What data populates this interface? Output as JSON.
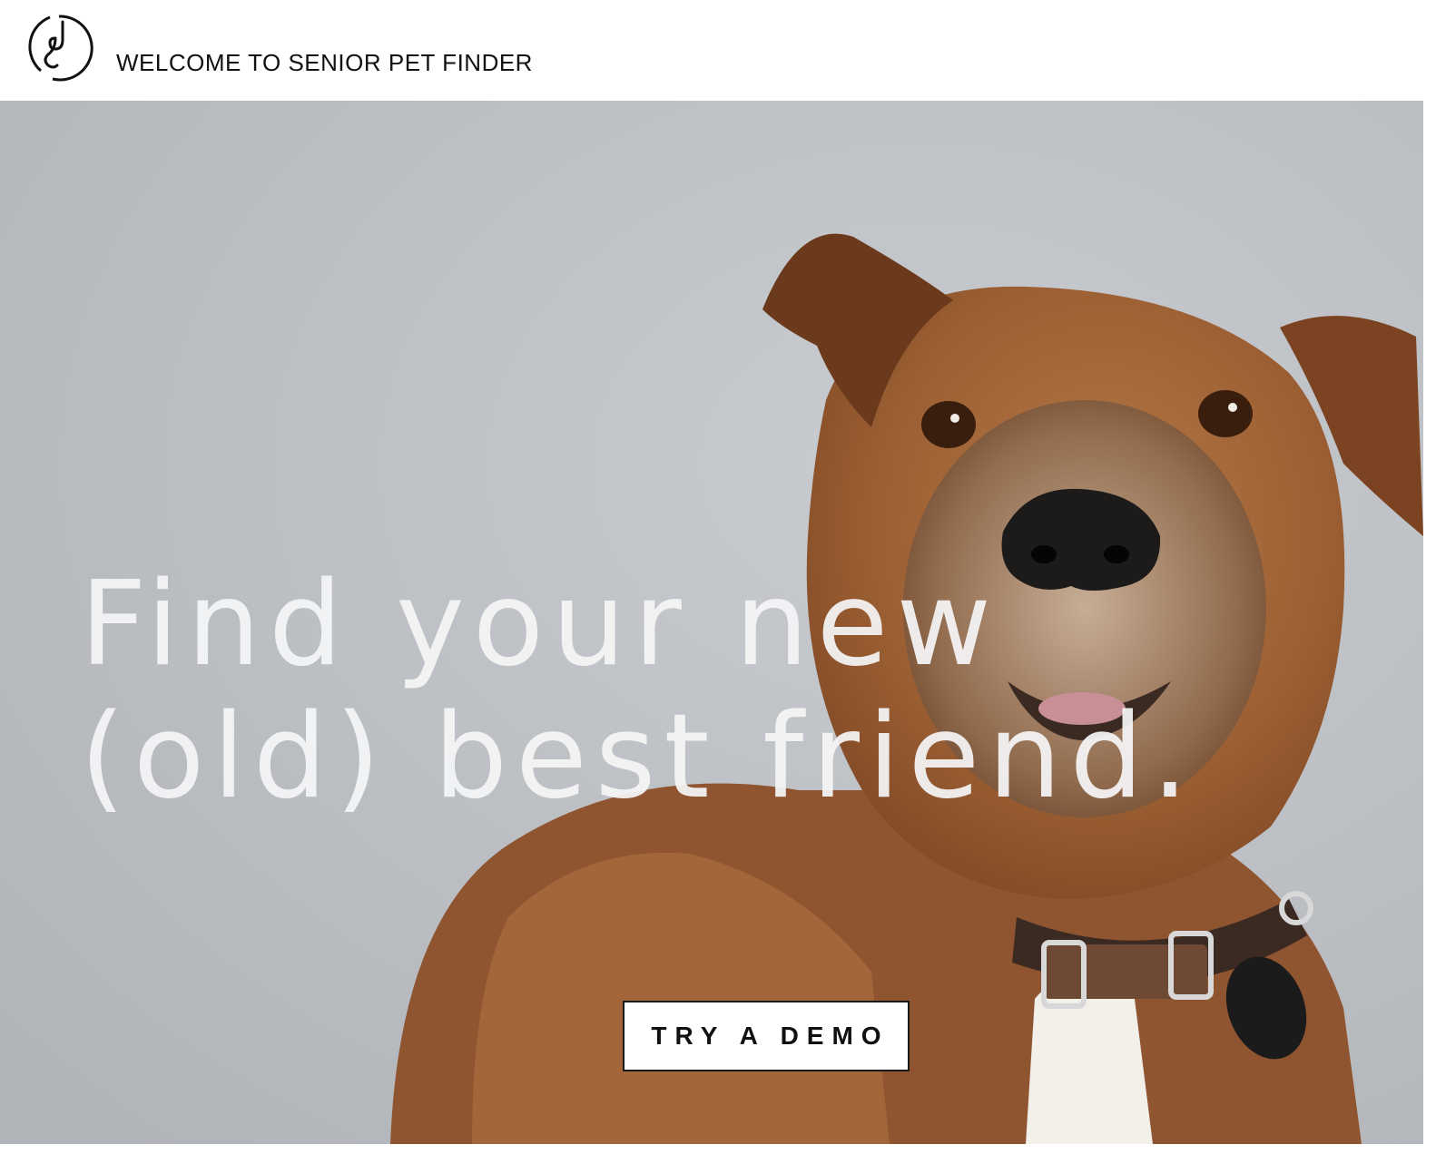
{
  "header": {
    "logo_icon": "swirl-logo-icon",
    "title": "WELCOME TO SENIOR PET FINDER"
  },
  "hero": {
    "background_image": "senior-brown-dog-photo",
    "headline_line1": "Find your new",
    "headline_line2": "(old) best friend.",
    "cta_label": "TRY A DEMO"
  },
  "colors": {
    "header_bg": "#ffffff",
    "hero_bg": "#c0c3c8",
    "dog_fur": "#a86a3c",
    "headline_text": "#f5f5f6",
    "button_bg": "#ffffff",
    "button_text": "#111111"
  }
}
